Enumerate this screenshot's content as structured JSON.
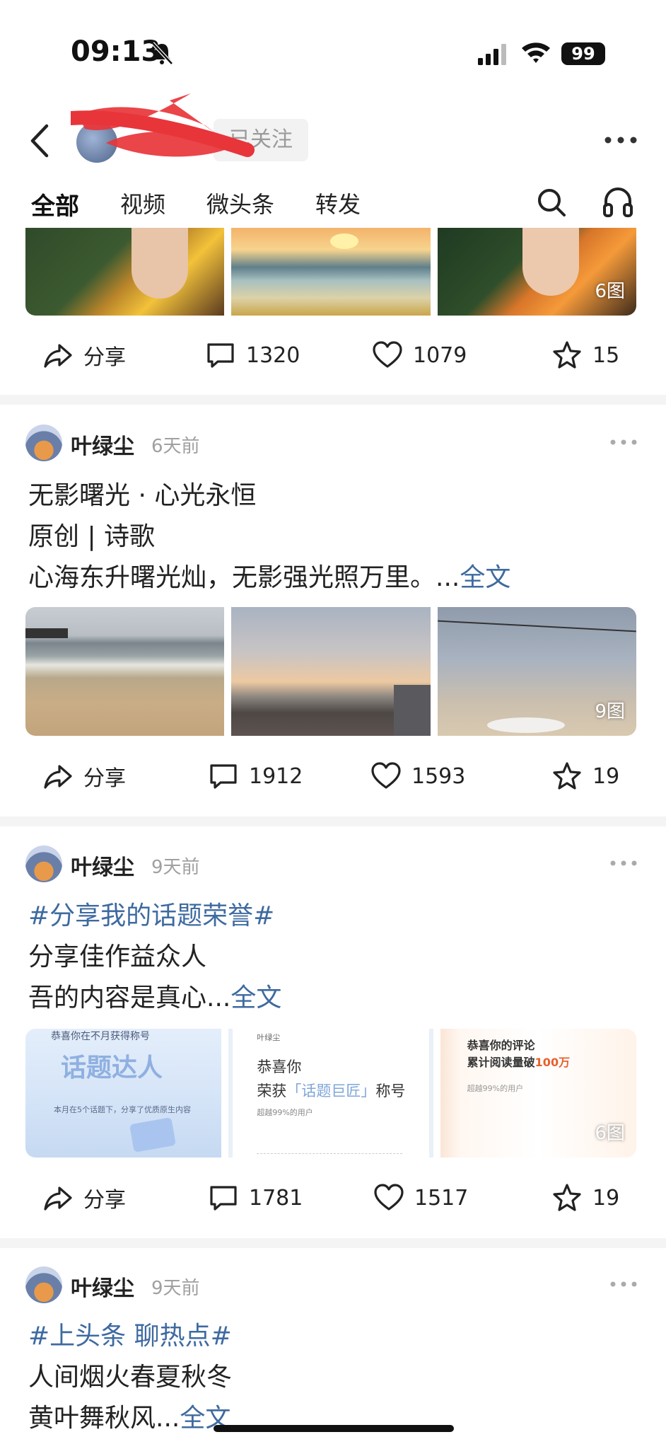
{
  "status": {
    "time": "09:13",
    "battery": "99"
  },
  "header": {
    "follow_label": "已关注"
  },
  "tabs": [
    "全部",
    "视频",
    "微头条",
    "转发"
  ],
  "post0": {
    "image_count": "6图",
    "share": "分享",
    "comments": "1320",
    "likes": "1079",
    "stars": "15"
  },
  "post1": {
    "author": "叶绿尘",
    "time": "6天前",
    "lines": [
      "无影曙光 · 心光永恒",
      "原创 | 诗歌",
      "心海东升曙光灿，无影强光照万里。..."
    ],
    "full_text_link": "全文",
    "image_count": "9图",
    "share": "分享",
    "comments": "1912",
    "likes": "1593",
    "stars": "19"
  },
  "post2": {
    "author": "叶绿尘",
    "time": "9天前",
    "hashtag": "#分享我的话题荣誉#",
    "lines": [
      "分享佳作益众人",
      "吾的内容是真心..."
    ],
    "full_text_link": "全文",
    "img1_title": "恭喜你在不月获得称号",
    "img1_badge": "话题达人",
    "img1_note": "本月在5个话题下，分享了优质原生内容",
    "img2_small": "叶绿尘",
    "img2_line1": "恭喜你",
    "img2_line2_a": "荣获",
    "img2_line2_b": "「话题巨匠」",
    "img2_line2_c": "称号",
    "img2_note": "超越99%的用户",
    "img3_line1": "恭喜你的评论",
    "img3_line2_a": "累计阅读量破",
    "img3_line2_b": "100万",
    "img3_note": "超越99%的用户",
    "image_count": "6图",
    "share": "分享",
    "comments": "1781",
    "likes": "1517",
    "stars": "19"
  },
  "post3": {
    "author": "叶绿尘",
    "time": "9天前",
    "hashtag": "#上头条 聊热点#",
    "lines": [
      "人间烟火春夏秋冬",
      "黄叶舞秋风..."
    ],
    "full_text_link": "全文"
  },
  "colors": {
    "link": "#3e6aa0",
    "redaction": "#e8353a",
    "time_grey": "#a0a0a0"
  },
  "icons": [
    "bell-muted-icon",
    "signal-icon",
    "wifi-icon",
    "back-icon",
    "more-icon",
    "search-icon",
    "headphone-icon",
    "share-icon",
    "comment-icon",
    "heart-icon",
    "star-icon"
  ]
}
